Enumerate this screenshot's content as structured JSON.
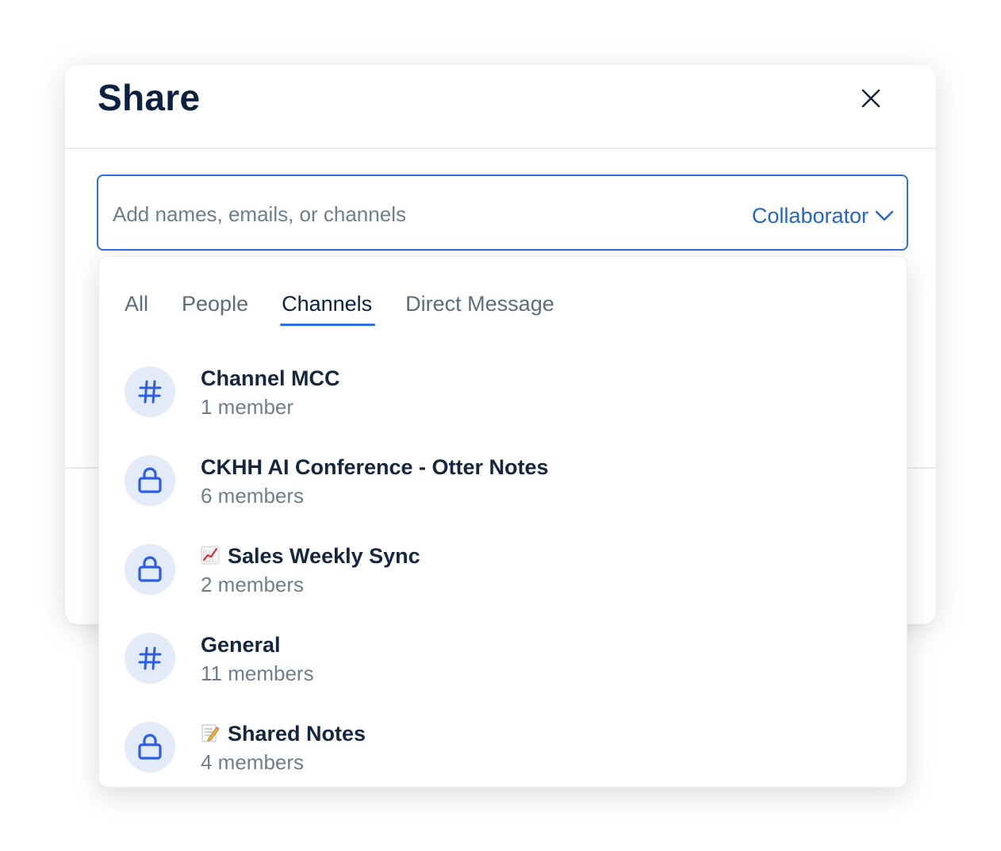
{
  "dialog": {
    "title": "Share",
    "close_icon": "close-icon"
  },
  "share_input": {
    "placeholder": "Add names, emails, or channels",
    "value": "",
    "role_label": "Collaborator",
    "role_icon": "chevron-down-icon"
  },
  "dropdown": {
    "tabs": [
      {
        "label": "All",
        "active": false
      },
      {
        "label": "People",
        "active": false
      },
      {
        "label": "Channels",
        "active": true
      },
      {
        "label": "Direct Message",
        "active": false
      }
    ],
    "channels": [
      {
        "name": "Channel MCC",
        "members": "1 member",
        "icon": "hash-icon",
        "emoji": ""
      },
      {
        "name": "CKHH AI Conference - Otter Notes",
        "members": "6 members",
        "icon": "lock-icon",
        "emoji": ""
      },
      {
        "name": "Sales Weekly Sync",
        "members": "2 members",
        "icon": "lock-icon",
        "emoji": "chart-increasing-emoji"
      },
      {
        "name": "General",
        "members": "11 members",
        "icon": "hash-icon",
        "emoji": ""
      },
      {
        "name": "Shared Notes",
        "members": "4 members",
        "icon": "lock-icon",
        "emoji": "memo-emoji"
      }
    ]
  },
  "colors": {
    "accent": "#2f6fdc",
    "link": "#2565c9",
    "title": "#0b2140",
    "muted": "#6f7d8c",
    "avatar_bg": "#e4ebf8",
    "icon": "#2b5fe0"
  }
}
